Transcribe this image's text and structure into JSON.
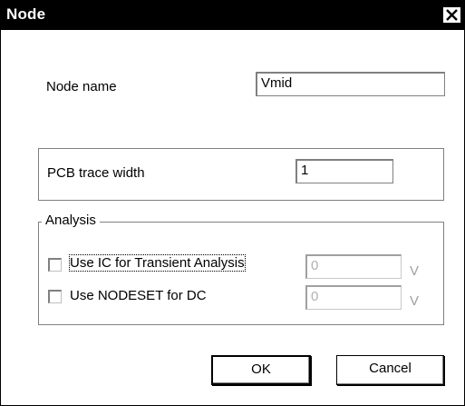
{
  "window": {
    "title": "Node",
    "close_icon": "close-icon"
  },
  "node_name": {
    "label": "Node name",
    "value": "Vmid"
  },
  "pcb": {
    "label": "PCB trace width",
    "value": "1"
  },
  "analysis": {
    "legend": "Analysis",
    "ic": {
      "label": "Use IC for Transient Analysis",
      "checked": false,
      "value": "0",
      "unit": "V"
    },
    "nodeset": {
      "label": "Use NODESET for DC",
      "checked": false,
      "value": "0",
      "unit": "V"
    }
  },
  "buttons": {
    "ok": "OK",
    "cancel": "Cancel"
  }
}
